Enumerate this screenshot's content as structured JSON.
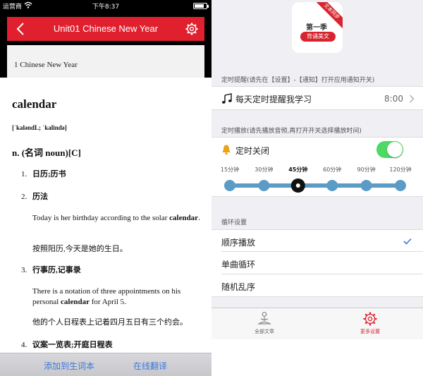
{
  "left": {
    "status": {
      "carrier": "运营商",
      "time": "下午8:37",
      "battery_level": 0.8
    },
    "navbar": {
      "title": "Unit01   Chinese New Year"
    },
    "lesson_row": {
      "label": "1 Chinese New Year"
    },
    "entry": {
      "word": "calendar",
      "phonetic": "[ˈkaləndL; ˈkalində]",
      "pos": "n. (名词 noun)[C]",
      "senses": [
        {
          "num": "1.",
          "text": "日历;历书"
        },
        {
          "num": "2.",
          "text": "历法"
        },
        {
          "num": "3.",
          "text": "行事历,记事录"
        },
        {
          "num": "4.",
          "text": "议案一览表;开庭日程表"
        }
      ],
      "examples": [
        {
          "en_pre": "Today is her birthday according to the solar ",
          "en_bold": "calendar",
          "en_post": ".",
          "zh": "按照阳历,今天是她的生日。"
        },
        {
          "en_pre": "There is a notation of three appointments on his personal ",
          "en_bold": "calendar",
          "en_post": " for April 5.",
          "zh": "他的个人日程表上记着四月五日有三个约会。"
        }
      ]
    },
    "bottom_bar": {
      "add_to_vocab": "添加到生词本",
      "online_translate": "在线翻译"
    }
  },
  "right": {
    "logo": {
      "ribbon": "文本同步",
      "season": "第一季",
      "pill": "背诵美文"
    },
    "reminder": {
      "section_header": "定时提醒(请先在【设置】-【通知】打开应用通知开关)",
      "label": "每天定时提醒我学习",
      "value": "8:00"
    },
    "timer": {
      "section_header": "定时播放(请先播放音频,再打开开关选择播放时间)",
      "label": "定时关闭",
      "toggle_on": true,
      "options": [
        "15分钟",
        "30分钟",
        "45分钟",
        "60分钟",
        "90分钟",
        "120分钟"
      ],
      "selected_index": 2
    },
    "loop": {
      "section_header": "循环设置",
      "items": [
        "顺序播放",
        "单曲循环",
        "随机乱序"
      ],
      "selected_index": 0
    },
    "tabbar": {
      "tabs": [
        {
          "label": "全部文章",
          "icon": "meditation-person-icon"
        },
        {
          "label": "更多设置",
          "icon": "gear-icon"
        }
      ],
      "active_index": 1
    },
    "colors": {
      "accent_red": "#e0202e",
      "toggle_green": "#4cd964",
      "slider_blue": "#5b9cc7",
      "link_blue": "#3a78d8"
    }
  }
}
